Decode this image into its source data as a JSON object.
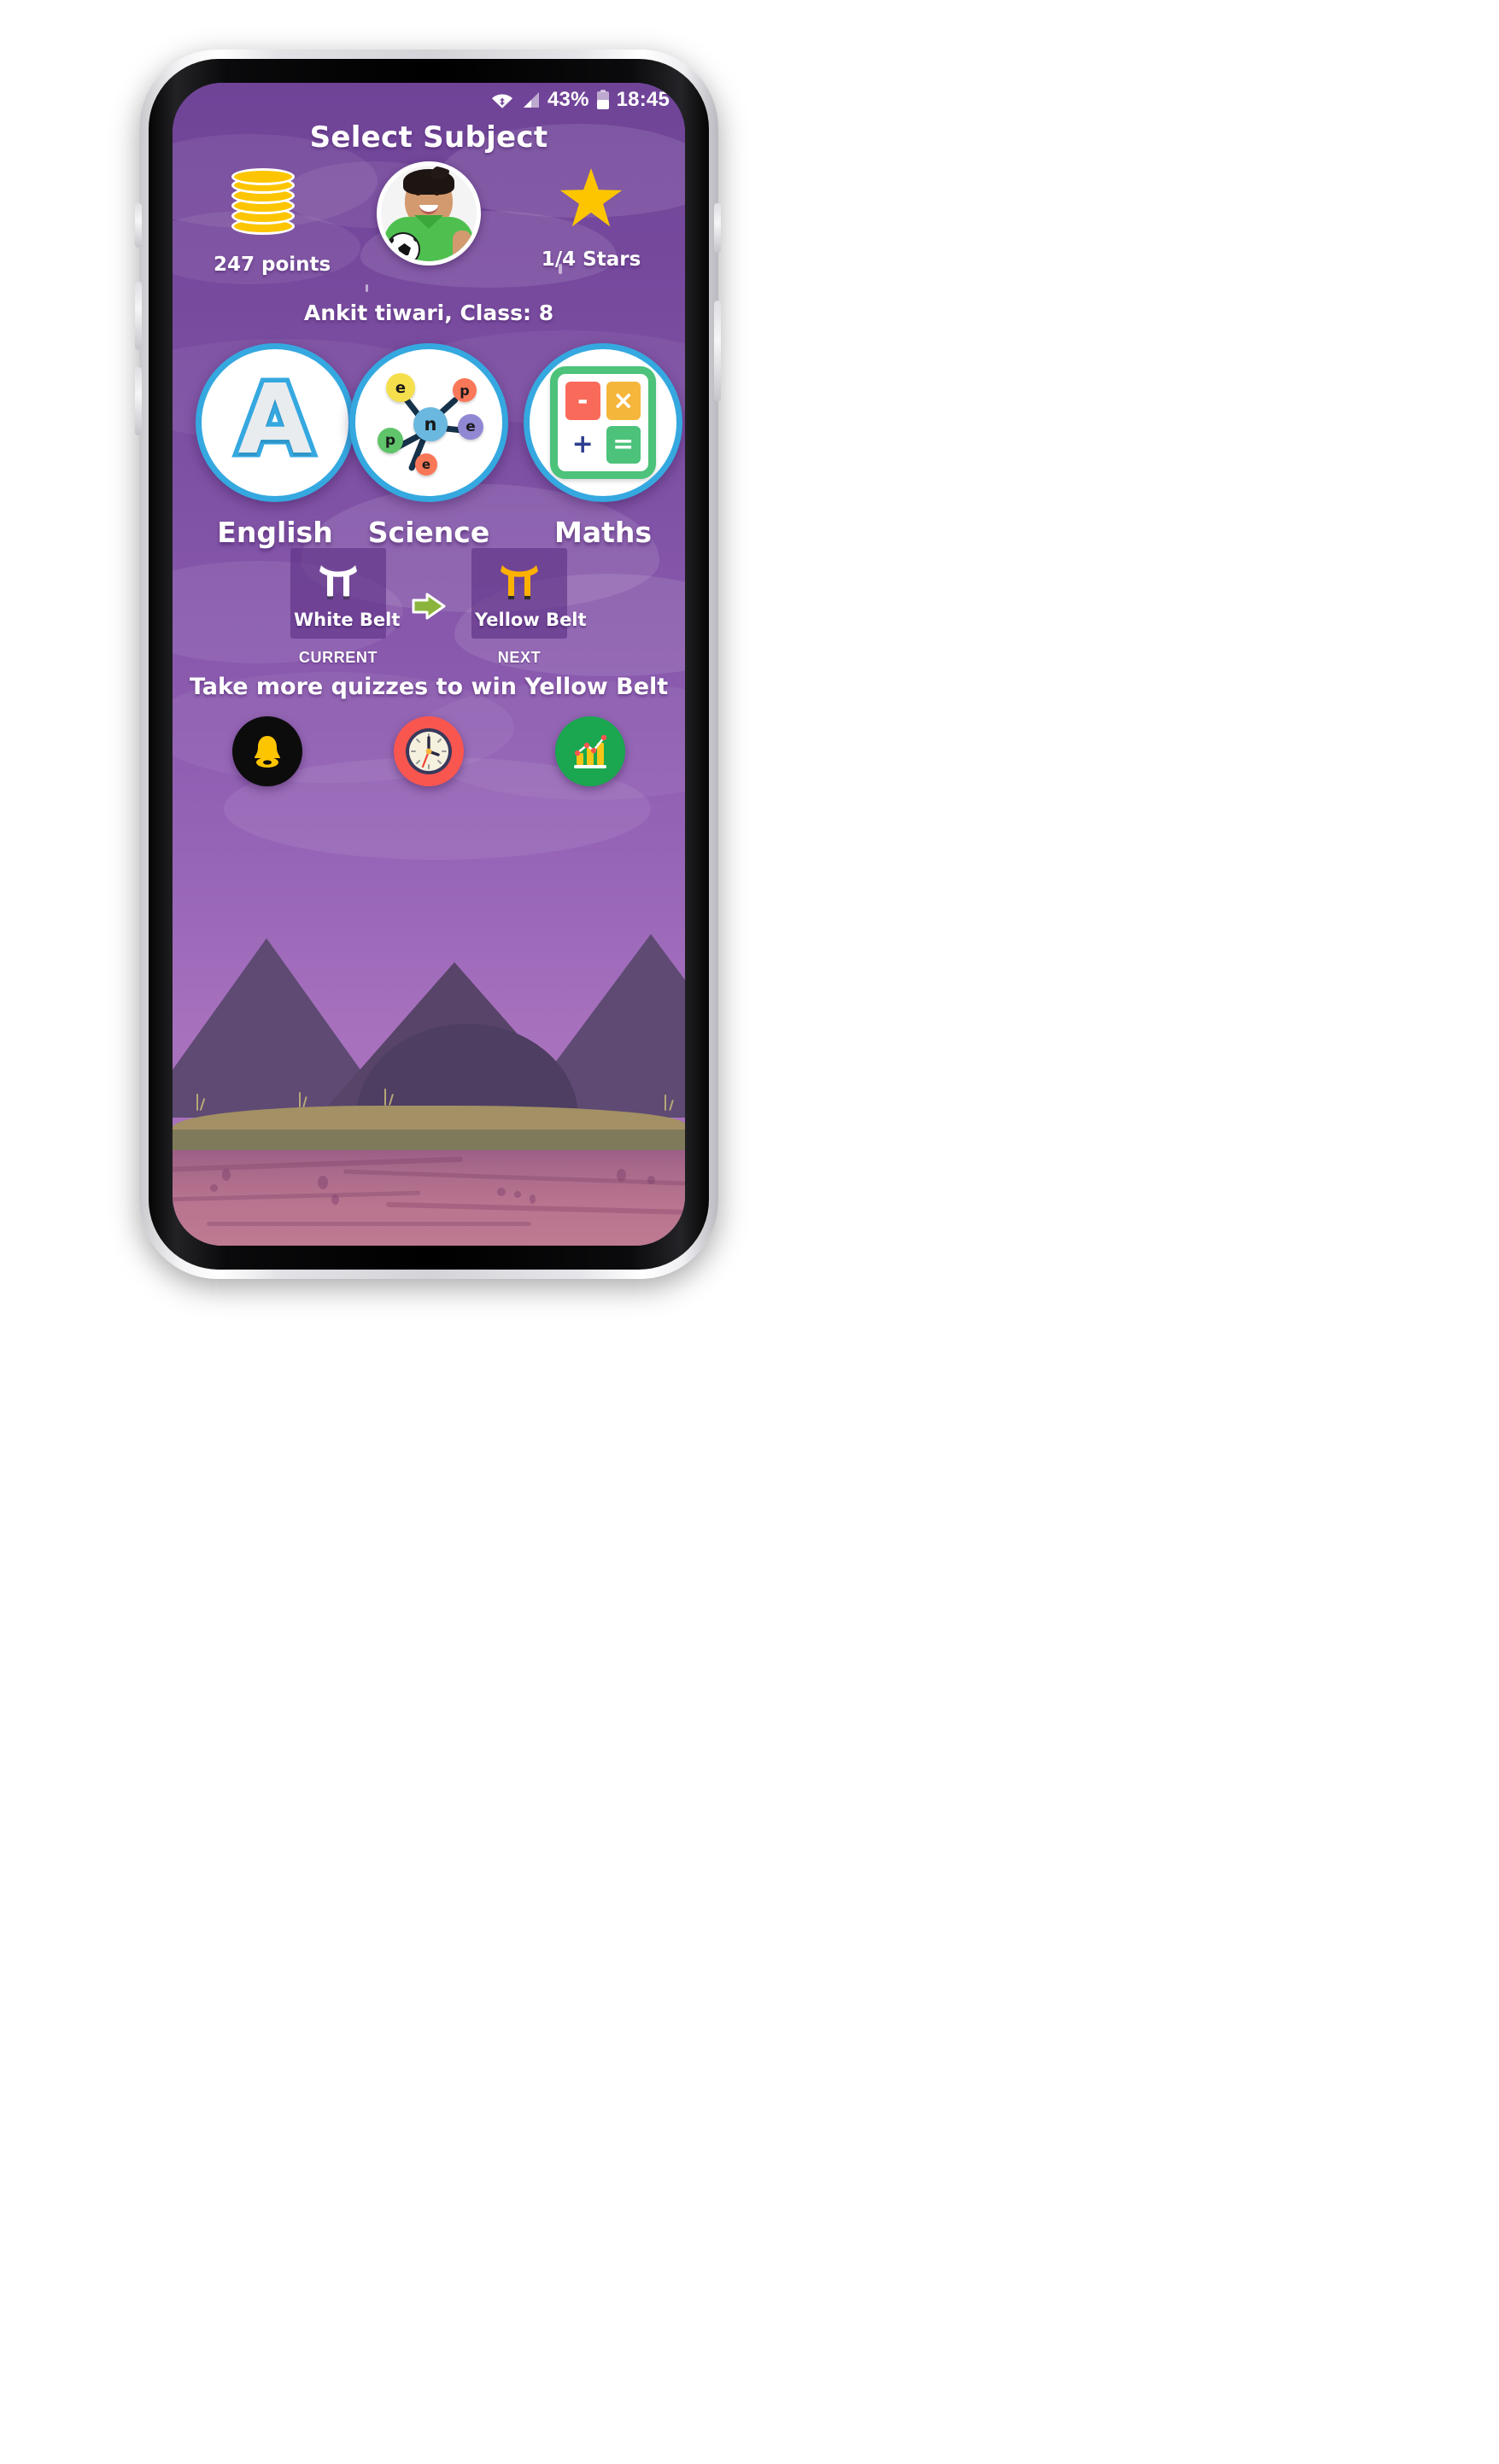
{
  "status_bar": {
    "wifi_icon": "wifi-icon",
    "signal_icon": "signal-icon",
    "battery_percent": "43%",
    "battery_icon": "battery-icon",
    "time": "18:45"
  },
  "header": {
    "title": "Select Subject"
  },
  "profile": {
    "points_label": "247 points",
    "points_icon": "coin-stack-icon",
    "avatar_icon": "user-avatar",
    "stars_label": "1/4 Stars",
    "star_icon": "star-icon",
    "user_line": "Ankit  tiwari, Class: 8"
  },
  "subjects": [
    {
      "label": "English",
      "icon": "letter-a-icon",
      "glyph": "A"
    },
    {
      "label": "Science",
      "icon": "atom-icon"
    },
    {
      "label": "Maths",
      "icon": "calculator-icon"
    }
  ],
  "atom": {
    "center": "n",
    "nodes": [
      "e",
      "p",
      "e",
      "e",
      "p"
    ]
  },
  "calculator": {
    "keys": [
      "-",
      "×",
      "+",
      "="
    ]
  },
  "belts": {
    "current": {
      "name": "White Belt",
      "state": "CURRENT",
      "icon": "white-belt-icon",
      "color": "#ffffff"
    },
    "next": {
      "name": "Yellow Belt",
      "state": "NEXT",
      "icon": "yellow-belt-icon",
      "color": "#ffb100"
    },
    "arrow_icon": "arrow-right-icon",
    "hint": "Take more quizzes to win Yellow Belt"
  },
  "actions": [
    {
      "name": "notifications",
      "icon": "bell-icon",
      "bg": "#0c0c0c",
      "fg": "#fdc500"
    },
    {
      "name": "timer",
      "icon": "clock-icon",
      "bg": "#f9564f",
      "fg": "#f5f1de"
    },
    {
      "name": "statistics",
      "icon": "bar-chart-icon",
      "bg": "#1aa74f",
      "fg": "#f5c518"
    }
  ],
  "colors": {
    "sky_top": "#6f4497",
    "sky_bottom": "#a871bd",
    "accent_blue": "#35a8e0",
    "coin_yellow": "#fdc500",
    "mountain": "#5e4a73",
    "ground": "#a39064",
    "soil": "#b9748f"
  }
}
